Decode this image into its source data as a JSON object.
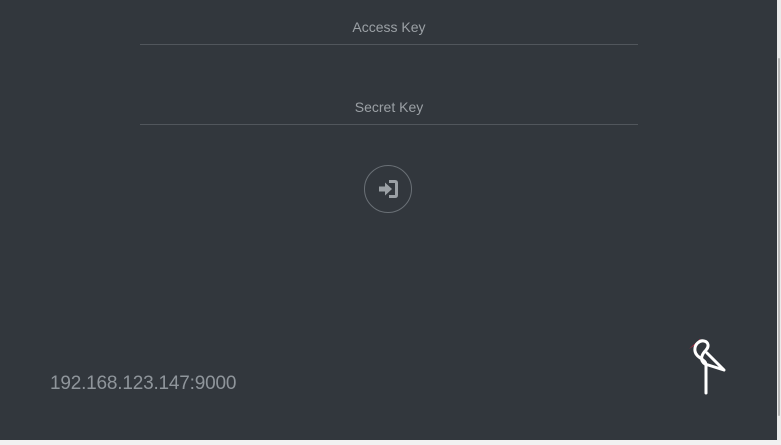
{
  "login": {
    "access_key_placeholder": "Access Key",
    "access_key_value": "",
    "secret_key_placeholder": "Secret Key",
    "secret_key_value": "",
    "submit_icon": "sign-in-icon"
  },
  "footer": {
    "host": "192.168.123.147:9000",
    "logo_icon": "minio-crane-logo"
  },
  "colors": {
    "background": "#32373d",
    "input_underline": "#51565c",
    "placeholder_text": "#9ba0a5",
    "host_text": "#8f959b",
    "logo_accent": "#c72c48",
    "logo_body": "#ffffff"
  }
}
